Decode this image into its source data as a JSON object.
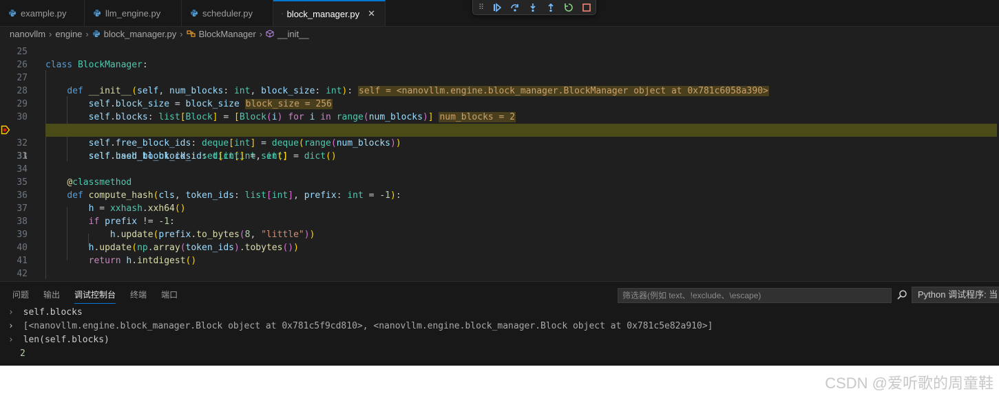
{
  "tabs": [
    {
      "label": "example.py"
    },
    {
      "label": "llm_engine.py"
    },
    {
      "label": "scheduler.py"
    },
    {
      "label": "block_manager.py",
      "active": true
    }
  ],
  "tab_close": "✕",
  "breadcrumb": [
    "nanovllm",
    "engine",
    "block_manager.py",
    "BlockManager",
    "__init__"
  ],
  "editor": {
    "line_numbers": [
      "25",
      "26",
      "27",
      "28",
      "29",
      "30",
      "31",
      "32",
      "33",
      "34",
      "35",
      "36",
      "37",
      "38",
      "39",
      "40",
      "41",
      "42"
    ],
    "current_line": "31"
  },
  "inline_values": {
    "self": "self = <nanovllm.engine.block_manager.BlockManager object at 0x781c6058a390>",
    "block_size": "block_size = 256",
    "num_blocks": "num_blocks = 2"
  },
  "panel": {
    "tabs": [
      "问题",
      "输出",
      "调试控制台",
      "终端",
      "端口"
    ],
    "active_tab": "调试控制台",
    "filter_placeholder": "筛选器(例如 text、!exclude、\\escape)",
    "debug_target": "Python 调试程序: 当"
  },
  "console": {
    "in1": "self.blocks",
    "out1": "[<nanovllm.engine.block_manager.Block object at 0x781c5f9cd810>, <nanovllm.engine.block_manager.Block object at 0x781c5e82a910>]",
    "in2": "len(self.blocks)",
    "out2": "2"
  },
  "watermark": "CSDN @爱听歌的周童鞋",
  "colors": {
    "accent": "#0078d4",
    "current_line": "#4b4b18",
    "breakpoint": "#ffcc00"
  }
}
